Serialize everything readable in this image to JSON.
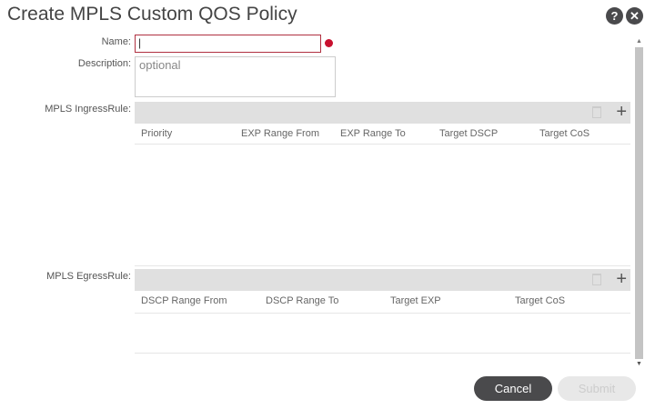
{
  "title": "Create MPLS Custom QOS Policy",
  "help_icon": "?",
  "close_icon": "✕",
  "form": {
    "name_label": "Name:",
    "name_value": "|",
    "description_label": "Description:",
    "description_placeholder": "optional"
  },
  "ingress": {
    "label": "MPLS IngressRule:",
    "columns": [
      "Priority",
      "EXP Range From",
      "EXP Range To",
      "Target DSCP",
      "Target CoS"
    ]
  },
  "egress": {
    "label": "MPLS EgressRule:",
    "columns": [
      "DSCP Range From",
      "DSCP Range To",
      "Target EXP",
      "Target CoS"
    ]
  },
  "add_symbol": "+",
  "buttons": {
    "cancel": "Cancel",
    "submit": "Submit"
  },
  "colors": {
    "error": "#c8102e",
    "cancel_bg": "#4a4a4c",
    "submit_bg": "#e8e8e8"
  }
}
